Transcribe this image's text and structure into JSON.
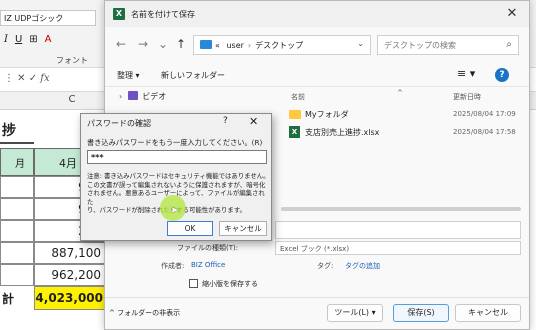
{
  "excel": {
    "font_name": "IZ UDPゴシック",
    "font_tools": [
      "I",
      "U",
      "⊞",
      "A"
    ],
    "font_group_label": "フォント",
    "fx_label": "fx",
    "column_c": "C",
    "title_fragment": "捗",
    "month_label": "月",
    "april_label": "4月",
    "values": [
      "977",
      "951",
      "243",
      "887,100",
      "962,200"
    ],
    "total_label": "計",
    "total_value": "4,023,000"
  },
  "save_dialog": {
    "title": "名前を付けて保存",
    "close": "✕",
    "nav": {
      "back": "←",
      "forward": "→",
      "down": "⌄",
      "up": "↑"
    },
    "address": {
      "prefix": "«",
      "user": "user",
      "sep": "›",
      "folder": "デスクトップ",
      "dropdown": "⌄"
    },
    "refresh": "↻",
    "search_placeholder": "デスクトップの検索",
    "search_icon": "⌕",
    "toolbar": {
      "organize": "整理 ▾",
      "new_folder": "新しいフォルダー",
      "view": "≡ ▾",
      "help": "?"
    },
    "left_pane": {
      "video": "ビデオ",
      "chevron": "›"
    },
    "list": {
      "col_name": "名前",
      "col_date": "更新日時",
      "caret": "^",
      "files": [
        {
          "name": "Myフォルダ",
          "date": "2025/08/04 17:09",
          "type": "folder"
        },
        {
          "name": "支店別売上進捗.xlsx",
          "date": "2025/08/04 17:58",
          "type": "xlsx"
        }
      ]
    },
    "file_type_label": "ファイルの種類(T):",
    "file_type_value": "Excel ブック (*.xlsx)",
    "author_label": "作成者:",
    "author_value": "BIZ Office",
    "tag_label": "タグ:",
    "tag_value": "タグの追加",
    "thumbnail_label": "縮小版を保存する",
    "hide_folders": "フォルダーの非表示",
    "tools_button": "ツール(L) ▾",
    "save_button": "保存(S)",
    "cancel_button": "キャンセル"
  },
  "password_dialog": {
    "title": "パスワードの確認",
    "help": "?",
    "close": "✕",
    "prompt": "書き込みパスワードをもう一度入力してください。(R)",
    "input_value": "***",
    "note": "注意: 書き込みパスワードはセキュリティ機能ではありません。\nこの文書が誤って編集されないように保護されますが、暗号化\nされません。悪意あるユーザーによって、ファイルが編集された\nり、パスワードが削除されたりする可能性があります。",
    "ok": "OK",
    "cancel": "キャンセル"
  },
  "colors": {
    "accent": "#1a73c8",
    "excel_green": "#1d6f42",
    "header_green": "#c4ead5",
    "total_yellow": "#fff200",
    "cursor_highlight": "#b2e63c"
  }
}
